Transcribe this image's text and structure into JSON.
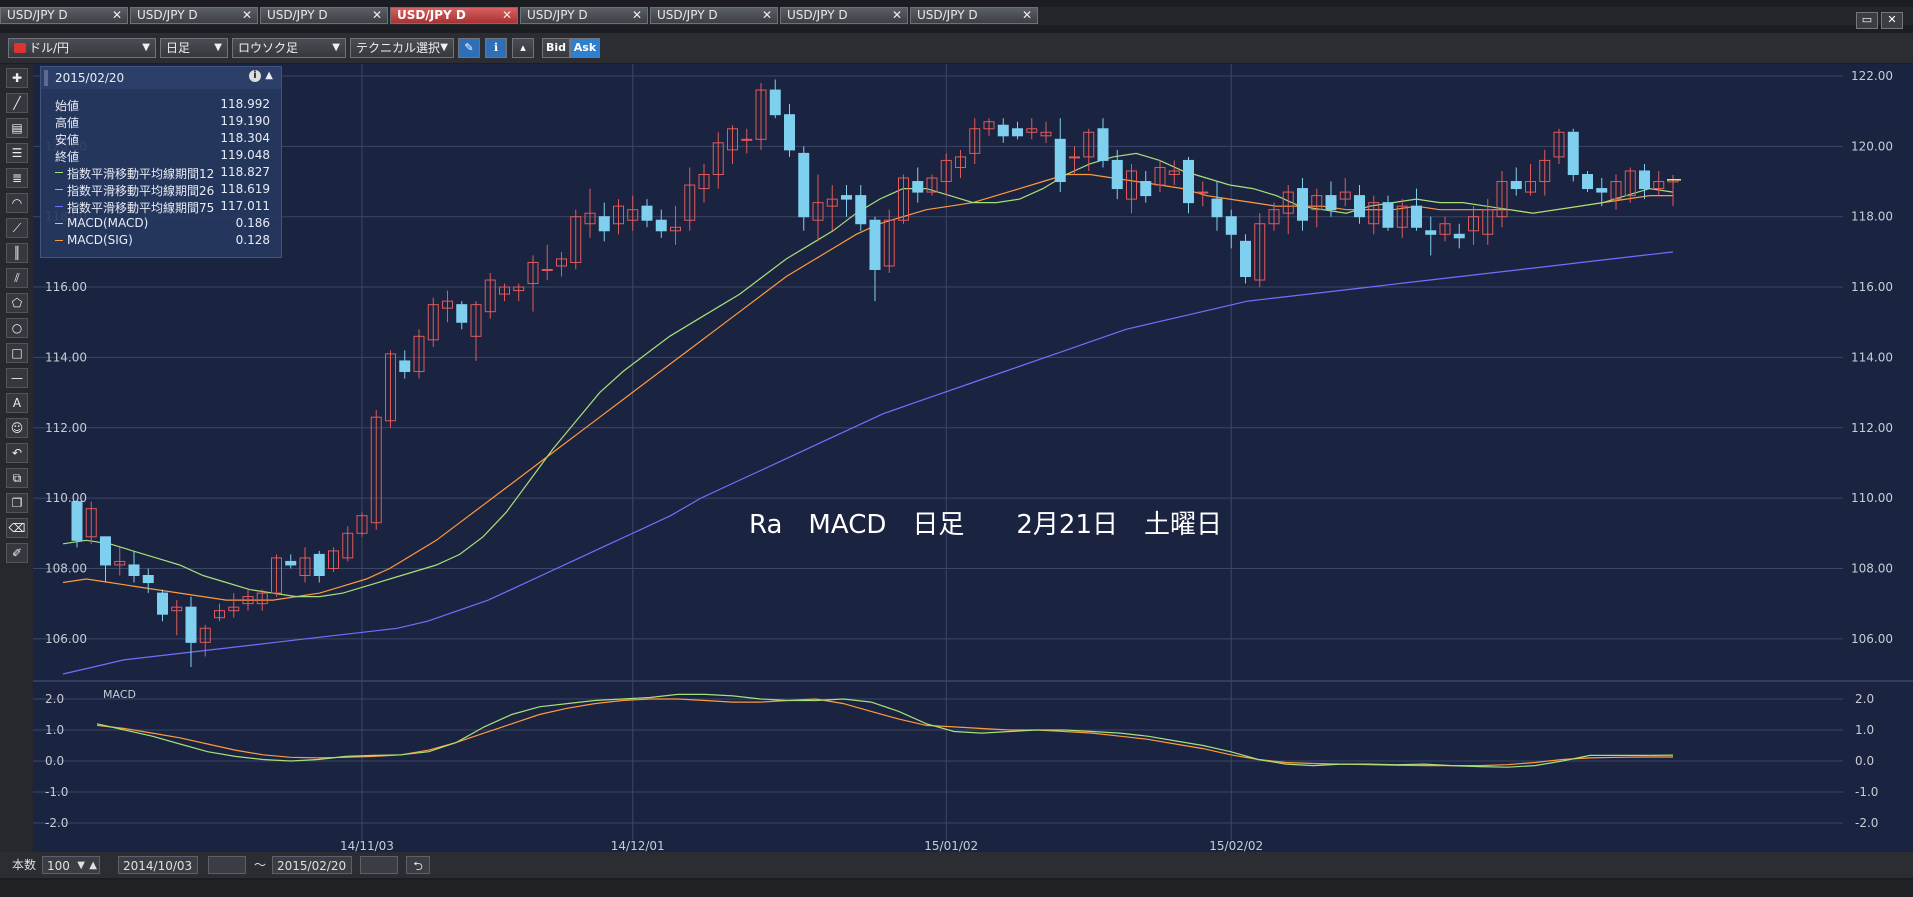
{
  "tabs": [
    {
      "label": "USD/JPY D",
      "active": false
    },
    {
      "label": "USD/JPY D",
      "active": false
    },
    {
      "label": "USD/JPY D",
      "active": false
    },
    {
      "label": "USD/JPY D",
      "active": true
    },
    {
      "label": "USD/JPY D",
      "active": false
    },
    {
      "label": "USD/JPY D",
      "active": false
    },
    {
      "label": "USD/JPY D",
      "active": false
    },
    {
      "label": "USD/JPY D",
      "active": false
    }
  ],
  "toolbar": {
    "pair": "ドル/円",
    "timeframe": "日足",
    "chart_type": "ロウソク足",
    "technical": "テクニカル選択",
    "bid": "Bid",
    "ask": "Ask"
  },
  "info": {
    "date": "2015/02/20",
    "rows": [
      {
        "label": "始値",
        "value": "118.992",
        "color": ""
      },
      {
        "label": "高値",
        "value": "119.190",
        "color": ""
      },
      {
        "label": "安値",
        "value": "118.304",
        "color": ""
      },
      {
        "label": "終値",
        "value": "119.048",
        "color": ""
      },
      {
        "label": "指数平滑移動平均線期間12",
        "value": "118.827",
        "color": "#a6e07a"
      },
      {
        "label": "指数平滑移動平均線期間26",
        "value": "118.619",
        "color": "#ff9a3c"
      },
      {
        "label": "指数平滑移動平均線期間75",
        "value": "117.011",
        "color": "#7070ff"
      },
      {
        "label": "MACD(MACD)",
        "value": "0.186",
        "color": "#a6e07a"
      },
      {
        "label": "MACD(SIG)",
        "value": "0.128",
        "color": "#ff9a3c"
      }
    ]
  },
  "annotation": "Ra　MACD　日足　　2月21日　土曜日",
  "bottom": {
    "count_label": "本数",
    "count_value": "100",
    "start_date": "2014/10/03",
    "tilde": "～",
    "end_date": "2015/02/20"
  },
  "colors": {
    "up": "#e05a5a",
    "down": "#7fd0ef",
    "ema12": "#a6e07a",
    "ema26": "#ff9a3c",
    "ema75": "#7070ff",
    "bg": "#1a2340",
    "grid": "#3a4766"
  },
  "chart_data": [
    {
      "type": "candlestick",
      "ylim": [
        105.0,
        122.0
      ],
      "y_ticks": [
        "122.00",
        "120.00",
        "118.00",
        "116.00",
        "114.00",
        "112.00",
        "110.00",
        "108.00",
        "106.00"
      ],
      "x_ticks": [
        "14/11/03",
        "14/12/01",
        "15/01/02",
        "15/02/02"
      ],
      "candles": [
        [
          109.9,
          109.7,
          108.6,
          108.8
        ],
        [
          108.9,
          109.9,
          108.7,
          109.7
        ],
        [
          108.9,
          108.9,
          107.6,
          108.1
        ],
        [
          108.1,
          108.6,
          107.8,
          108.2
        ],
        [
          108.1,
          108.5,
          107.6,
          107.8
        ],
        [
          107.8,
          108.0,
          107.3,
          107.6
        ],
        [
          107.3,
          107.4,
          106.5,
          106.7
        ],
        [
          106.8,
          107.1,
          106.1,
          106.9
        ],
        [
          106.9,
          107.2,
          105.2,
          105.9
        ],
        [
          105.9,
          106.4,
          105.5,
          106.3
        ],
        [
          106.6,
          107.0,
          106.5,
          106.8
        ],
        [
          106.8,
          107.3,
          106.6,
          106.9
        ],
        [
          107.0,
          107.4,
          106.8,
          107.2
        ],
        [
          107.0,
          107.4,
          106.8,
          107.3
        ],
        [
          107.3,
          108.4,
          107.2,
          108.3
        ],
        [
          108.2,
          108.4,
          108.0,
          108.1
        ],
        [
          107.8,
          108.6,
          107.6,
          108.3
        ],
        [
          108.4,
          108.5,
          107.6,
          107.8
        ],
        [
          108.0,
          108.6,
          107.9,
          108.5
        ],
        [
          108.3,
          109.2,
          108.2,
          109.0
        ],
        [
          109.0,
          109.6,
          108.9,
          109.5
        ],
        [
          109.3,
          112.5,
          109.1,
          112.3
        ],
        [
          112.2,
          114.2,
          112.0,
          114.1
        ],
        [
          113.9,
          114.2,
          113.4,
          113.6
        ],
        [
          113.6,
          114.8,
          113.4,
          114.6
        ],
        [
          114.5,
          115.7,
          114.3,
          115.5
        ],
        [
          115.4,
          115.9,
          115.0,
          115.6
        ],
        [
          115.5,
          115.6,
          114.8,
          115.0
        ],
        [
          114.6,
          115.6,
          113.9,
          115.5
        ],
        [
          115.3,
          116.4,
          115.1,
          116.2
        ],
        [
          115.8,
          116.1,
          115.6,
          116.0
        ],
        [
          115.9,
          116.1,
          115.6,
          116.0
        ],
        [
          116.1,
          116.9,
          115.3,
          116.7
        ],
        [
          116.5,
          117.2,
          116.2,
          116.5
        ],
        [
          116.6,
          117.0,
          116.3,
          116.8
        ],
        [
          116.7,
          118.2,
          116.5,
          118.0
        ],
        [
          117.8,
          118.8,
          117.4,
          118.1
        ],
        [
          118.0,
          118.4,
          117.3,
          117.6
        ],
        [
          117.8,
          118.5,
          117.5,
          118.3
        ],
        [
          117.9,
          118.6,
          117.6,
          118.2
        ],
        [
          118.3,
          118.5,
          117.7,
          117.9
        ],
        [
          117.9,
          118.2,
          117.4,
          117.6
        ],
        [
          117.6,
          118.3,
          117.2,
          117.7
        ],
        [
          117.9,
          119.4,
          117.6,
          118.9
        ],
        [
          118.8,
          119.5,
          118.4,
          119.2
        ],
        [
          119.2,
          120.4,
          118.8,
          120.1
        ],
        [
          119.9,
          120.6,
          119.5,
          120.5
        ],
        [
          120.2,
          120.5,
          119.8,
          120.2
        ],
        [
          120.2,
          121.8,
          119.9,
          121.6
        ],
        [
          121.6,
          121.9,
          120.8,
          120.9
        ],
        [
          120.9,
          121.2,
          119.7,
          119.9
        ],
        [
          119.8,
          120.0,
          117.6,
          118.0
        ],
        [
          117.9,
          119.2,
          117.3,
          118.4
        ],
        [
          118.3,
          118.9,
          117.6,
          118.5
        ],
        [
          118.6,
          118.9,
          118.0,
          118.5
        ],
        [
          118.6,
          118.9,
          117.6,
          117.8
        ],
        [
          117.9,
          118.0,
          115.6,
          116.5
        ],
        [
          116.6,
          118.2,
          116.4,
          117.9
        ],
        [
          117.9,
          119.2,
          117.8,
          119.1
        ],
        [
          119.0,
          119.4,
          118.4,
          118.7
        ],
        [
          118.7,
          119.2,
          118.6,
          119.1
        ],
        [
          119.0,
          119.8,
          118.6,
          119.6
        ],
        [
          119.4,
          119.9,
          119.1,
          119.7
        ],
        [
          119.8,
          120.8,
          119.5,
          120.5
        ],
        [
          120.5,
          120.8,
          120.3,
          120.7
        ],
        [
          120.6,
          120.8,
          120.1,
          120.3
        ],
        [
          120.5,
          120.7,
          120.2,
          120.3
        ],
        [
          120.4,
          120.8,
          120.2,
          120.5
        ],
        [
          120.3,
          120.7,
          120.1,
          120.4
        ],
        [
          120.2,
          120.8,
          118.7,
          119.0
        ],
        [
          119.7,
          120.0,
          119.2,
          119.7
        ],
        [
          119.7,
          120.5,
          119.3,
          120.4
        ],
        [
          120.5,
          120.8,
          119.4,
          119.6
        ],
        [
          119.6,
          119.9,
          118.5,
          118.8
        ],
        [
          118.5,
          119.5,
          118.1,
          119.3
        ],
        [
          119.0,
          119.3,
          118.4,
          118.6
        ],
        [
          118.9,
          119.6,
          118.7,
          119.4
        ],
        [
          119.2,
          119.6,
          118.9,
          119.3
        ],
        [
          119.6,
          119.7,
          118.1,
          118.4
        ],
        [
          118.7,
          119.0,
          118.3,
          118.7
        ],
        [
          118.5,
          119.0,
          117.6,
          118.0
        ],
        [
          118.0,
          118.2,
          117.1,
          117.5
        ],
        [
          117.3,
          117.5,
          116.1,
          116.3
        ],
        [
          116.2,
          118.1,
          116.0,
          117.8
        ],
        [
          117.8,
          118.4,
          117.6,
          118.2
        ],
        [
          118.1,
          118.9,
          117.5,
          118.7
        ],
        [
          118.8,
          119.1,
          117.6,
          117.9
        ],
        [
          118.2,
          118.8,
          117.7,
          118.6
        ],
        [
          118.6,
          119.0,
          118.0,
          118.2
        ],
        [
          118.5,
          119.1,
          118.3,
          118.7
        ],
        [
          118.6,
          118.9,
          117.8,
          118.0
        ],
        [
          117.8,
          118.6,
          117.5,
          118.4
        ],
        [
          118.4,
          118.6,
          117.6,
          117.7
        ],
        [
          117.7,
          118.5,
          117.4,
          118.3
        ],
        [
          118.3,
          118.8,
          117.6,
          117.7
        ],
        [
          117.6,
          118.0,
          116.9,
          117.5
        ],
        [
          117.5,
          118.0,
          117.3,
          117.8
        ],
        [
          117.5,
          117.8,
          117.1,
          117.4
        ],
        [
          117.6,
          118.3,
          117.2,
          118.0
        ],
        [
          117.5,
          118.5,
          117.2,
          118.2
        ],
        [
          118.0,
          119.3,
          117.7,
          119.0
        ],
        [
          119.0,
          119.4,
          118.6,
          118.8
        ],
        [
          118.7,
          119.5,
          118.6,
          119.0
        ],
        [
          119.0,
          119.9,
          118.6,
          119.6
        ],
        [
          119.7,
          120.5,
          119.5,
          120.4
        ],
        [
          120.4,
          120.5,
          119.0,
          119.2
        ],
        [
          119.2,
          119.3,
          118.7,
          118.8
        ],
        [
          118.8,
          119.1,
          118.3,
          118.7
        ],
        [
          118.5,
          119.2,
          118.2,
          119.0
        ],
        [
          118.6,
          119.4,
          118.4,
          119.3
        ],
        [
          119.3,
          119.5,
          118.5,
          118.8
        ],
        [
          118.8,
          119.3,
          118.6,
          119.0
        ],
        [
          118.99,
          119.19,
          118.3,
          119.05
        ]
      ],
      "ema12": [
        108.7,
        108.8,
        108.7,
        108.5,
        108.3,
        108.1,
        107.8,
        107.6,
        107.4,
        107.3,
        107.2,
        107.2,
        107.3,
        107.5,
        107.7,
        107.9,
        108.1,
        108.4,
        108.9,
        109.6,
        110.5,
        111.4,
        112.2,
        113.0,
        113.6,
        114.1,
        114.6,
        115.0,
        115.4,
        115.8,
        116.3,
        116.8,
        117.2,
        117.6,
        118.1,
        118.5,
        118.8,
        118.8,
        118.6,
        118.4,
        118.4,
        118.5,
        118.8,
        119.2,
        119.5,
        119.7,
        119.8,
        119.6,
        119.3,
        119.1,
        118.9,
        118.8,
        118.6,
        118.3,
        118.2,
        118.1,
        118.3,
        118.4,
        118.5,
        118.4,
        118.4,
        118.3,
        118.2,
        118.1,
        118.2,
        118.3,
        118.4,
        118.6,
        118.8,
        118.7
      ],
      "ema26": [
        107.6,
        107.7,
        107.6,
        107.5,
        107.4,
        107.3,
        107.2,
        107.1,
        107.1,
        107.1,
        107.2,
        107.3,
        107.5,
        107.7,
        108.0,
        108.4,
        108.8,
        109.3,
        109.8,
        110.3,
        110.8,
        111.3,
        111.8,
        112.3,
        112.8,
        113.3,
        113.8,
        114.3,
        114.8,
        115.3,
        115.8,
        116.3,
        116.7,
        117.1,
        117.5,
        117.8,
        118.0,
        118.2,
        118.3,
        118.4,
        118.6,
        118.8,
        119.0,
        119.2,
        119.2,
        119.1,
        119.0,
        118.9,
        118.8,
        118.6,
        118.5,
        118.4,
        118.3,
        118.3,
        118.3,
        118.2,
        118.2,
        118.2,
        118.3,
        118.2,
        118.2,
        118.2,
        118.2,
        118.1,
        118.2,
        118.3,
        118.4,
        118.5,
        118.6,
        118.6
      ],
      "ema75": [
        105.0,
        105.2,
        105.4,
        105.5,
        105.6,
        105.7,
        105.8,
        105.9,
        106.0,
        106.1,
        106.2,
        106.3,
        106.5,
        106.8,
        107.1,
        107.5,
        107.9,
        108.3,
        108.7,
        109.1,
        109.5,
        110.0,
        110.4,
        110.8,
        111.2,
        111.6,
        112.0,
        112.4,
        112.7,
        113.0,
        113.3,
        113.6,
        113.9,
        114.2,
        114.5,
        114.8,
        115.0,
        115.2,
        115.4,
        115.6,
        115.7,
        115.8,
        115.9,
        116.0,
        116.1,
        116.2,
        116.3,
        116.4,
        116.5,
        116.6,
        116.7,
        116.8,
        116.9,
        117.0
      ]
    },
    {
      "type": "line",
      "title": "MACD",
      "ylim": [
        -2.0,
        2.0
      ],
      "y_ticks": [
        "2.0",
        "1.0",
        "0.0",
        "-1.0",
        "-2.0"
      ],
      "macd": [
        1.2,
        1.0,
        0.8,
        0.55,
        0.3,
        0.15,
        0.05,
        0.0,
        0.05,
        0.15,
        0.18,
        0.2,
        0.3,
        0.6,
        1.1,
        1.5,
        1.75,
        1.85,
        1.95,
        2.0,
        2.05,
        2.15,
        2.15,
        2.1,
        2.0,
        1.95,
        1.95,
        2.0,
        1.9,
        1.6,
        1.2,
        0.95,
        0.9,
        0.95,
        1.0,
        1.0,
        0.95,
        0.9,
        0.8,
        0.65,
        0.5,
        0.3,
        0.05,
        -0.1,
        -0.15,
        -0.1,
        -0.1,
        -0.12,
        -0.1,
        -0.15,
        -0.18,
        -0.2,
        -0.15,
        0.0,
        0.18,
        0.18,
        0.18,
        0.19
      ],
      "signal": [
        1.15,
        1.05,
        0.9,
        0.75,
        0.55,
        0.35,
        0.2,
        0.12,
        0.1,
        0.12,
        0.15,
        0.2,
        0.35,
        0.6,
        0.9,
        1.2,
        1.5,
        1.7,
        1.85,
        1.95,
        2.0,
        2.0,
        1.95,
        1.9,
        1.9,
        1.95,
        2.0,
        1.85,
        1.6,
        1.35,
        1.15,
        1.1,
        1.05,
        1.0,
        1.0,
        0.95,
        0.9,
        0.8,
        0.7,
        0.55,
        0.4,
        0.2,
        0.05,
        -0.05,
        -0.08,
        -0.1,
        -0.12,
        -0.14,
        -0.15,
        -0.15,
        -0.15,
        -0.12,
        -0.05,
        0.05,
        0.1,
        0.12,
        0.13,
        0.13
      ]
    }
  ]
}
